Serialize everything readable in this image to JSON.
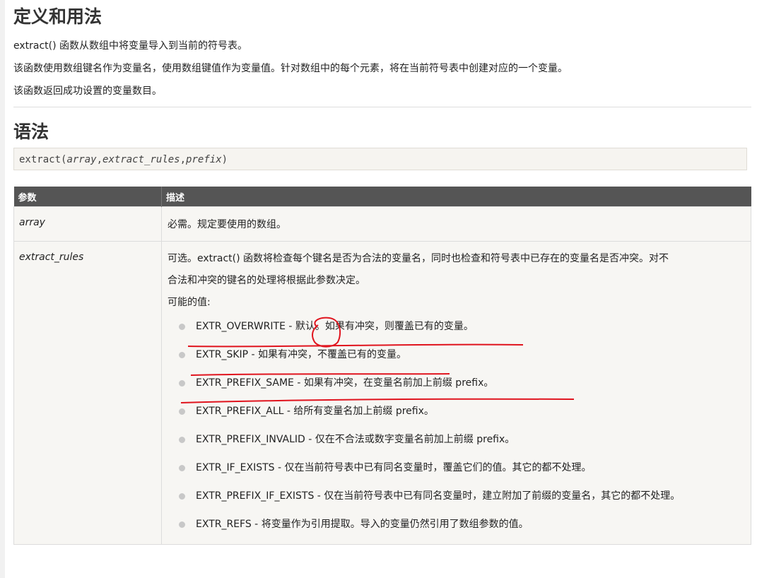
{
  "section1": {
    "title": "定义和用法",
    "p1": "extract() 函数从数组中将变量导入到当前的符号表。",
    "p2": "该函数使用数组键名作为变量名，使用数组键值作为变量值。针对数组中的每个元素，将在当前符号表中创建对应的一个变量。",
    "p3": "该函数返回成功设置的变量数目。"
  },
  "section2": {
    "title": "语法",
    "code_fn": "extract(",
    "code_arg1": "array",
    "code_sep1": ",",
    "code_arg2": "extract_rules",
    "code_sep2": ",",
    "code_arg3": "prefix",
    "code_end": ")"
  },
  "table": {
    "headers": [
      "参数",
      "描述"
    ],
    "rows": [
      {
        "param": "array",
        "desc": "必需。规定要使用的数组。"
      },
      {
        "param": "extract_rules",
        "desc_line1": "可选。extract() 函数将检查每个键名是否为合法的变量名，同时也检查和符号表中已存在的变量名是否冲突。对不",
        "desc_line2": "合法和冲突的键名的处理将根据此参数决定。",
        "desc_line3": "可能的值:",
        "options": [
          "EXTR_OVERWRITE - 默认。如果有冲突，则覆盖已有的变量。",
          "EXTR_SKIP - 如果有冲突，不覆盖已有的变量。",
          "EXTR_PREFIX_SAME - 如果有冲突，在变量名前加上前缀 prefix。",
          "EXTR_PREFIX_ALL - 给所有变量名加上前缀 prefix。",
          "EXTR_PREFIX_INVALID - 仅在不合法或数字变量名前加上前缀 prefix。",
          "EXTR_IF_EXISTS - 仅在当前符号表中已有同名变量时，覆盖它们的值。其它的都不处理。",
          "EXTR_PREFIX_IF_EXISTS - 仅在当前符号表中已有同名变量时，建立附加了前缀的变量名，其它的都不处理。",
          "EXTR_REFS - 将变量作为引用提取。导入的变量仍然引用了数组参数的值。"
        ]
      }
    ]
  },
  "colors": {
    "header_bg": "#555555",
    "cell_bg": "#f7f6f3",
    "annotation_red": "#e0141e"
  }
}
